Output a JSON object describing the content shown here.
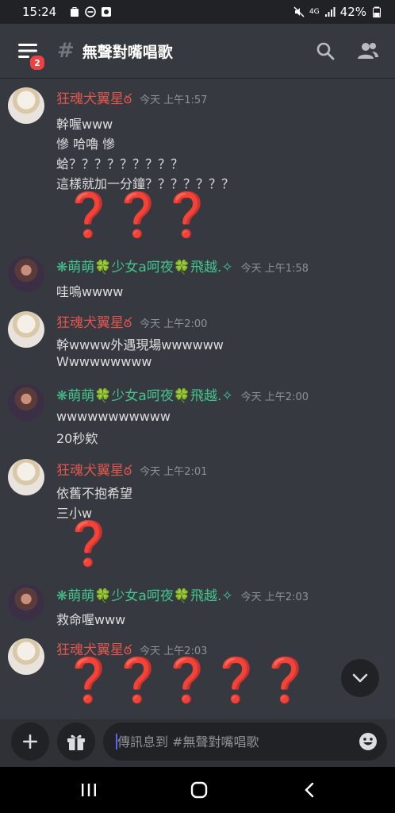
{
  "status_bar": {
    "time": "15:24",
    "battery": "42%",
    "network": "4G"
  },
  "header": {
    "notification_count": "2",
    "hash": "#",
    "channel_name": "無聲對嘴唱歌"
  },
  "users": {
    "red": {
      "name": "狂魂犬翼星ఠ",
      "color": "#e2564e"
    },
    "green": {
      "name": "❋萌萌🍀少女a呵夜🍀飛越.✧",
      "color": "#43c58d"
    }
  },
  "messages": [
    {
      "user": "狂魂犬翼星ఠ",
      "time": "今天 上午1:57",
      "lines": [
        "幹喔www",
        "慘 哈嚕 慘",
        "蛤？？？？？？？？？",
        "這樣就加一分鐘？？？？？？？"
      ],
      "emoji": [
        "❓",
        "❓",
        "❓"
      ]
    },
    {
      "user": "❋萌萌🍀少女a呵夜🍀飛越.✧",
      "time": "今天 上午1:58",
      "lines": [
        "哇嗚wwww"
      ]
    },
    {
      "user": "狂魂犬翼星ఠ",
      "time": "今天 上午2:00",
      "lines": [
        "幹wwww外遇現場wwwwww",
        "Wwwwwwwww"
      ]
    },
    {
      "user": "❋萌萌🍀少女a呵夜🍀飛越.✧",
      "time": "今天 上午2:00",
      "lines": [
        "wwwwwwwwwww",
        "20秒欸"
      ]
    },
    {
      "user": "狂魂犬翼星ఠ",
      "time": "今天 上午2:01",
      "lines": [
        "依舊不抱希望",
        "三小w"
      ],
      "emoji": [
        "❓"
      ]
    },
    {
      "user": "❋萌萌🍀少女a呵夜🍀飛越.✧",
      "time": "今天 上午2:03",
      "lines": [
        "救命喔www"
      ]
    },
    {
      "user": "狂魂犬翼星ఠ",
      "time": "今天 上午2:03",
      "lines": [],
      "emoji": [
        "❓",
        "❓",
        "❓",
        "❓",
        "❓"
      ]
    }
  ],
  "composer": {
    "placeholder": "傳訊息到 #無聲對嘴唱歌"
  },
  "icons": {
    "menu": "hamburger-icon",
    "search": "search-icon",
    "members": "members-icon",
    "add": "plus-icon",
    "gift": "gift-icon",
    "emoji": "smiley-icon",
    "scroll": "chevron-down-icon"
  }
}
